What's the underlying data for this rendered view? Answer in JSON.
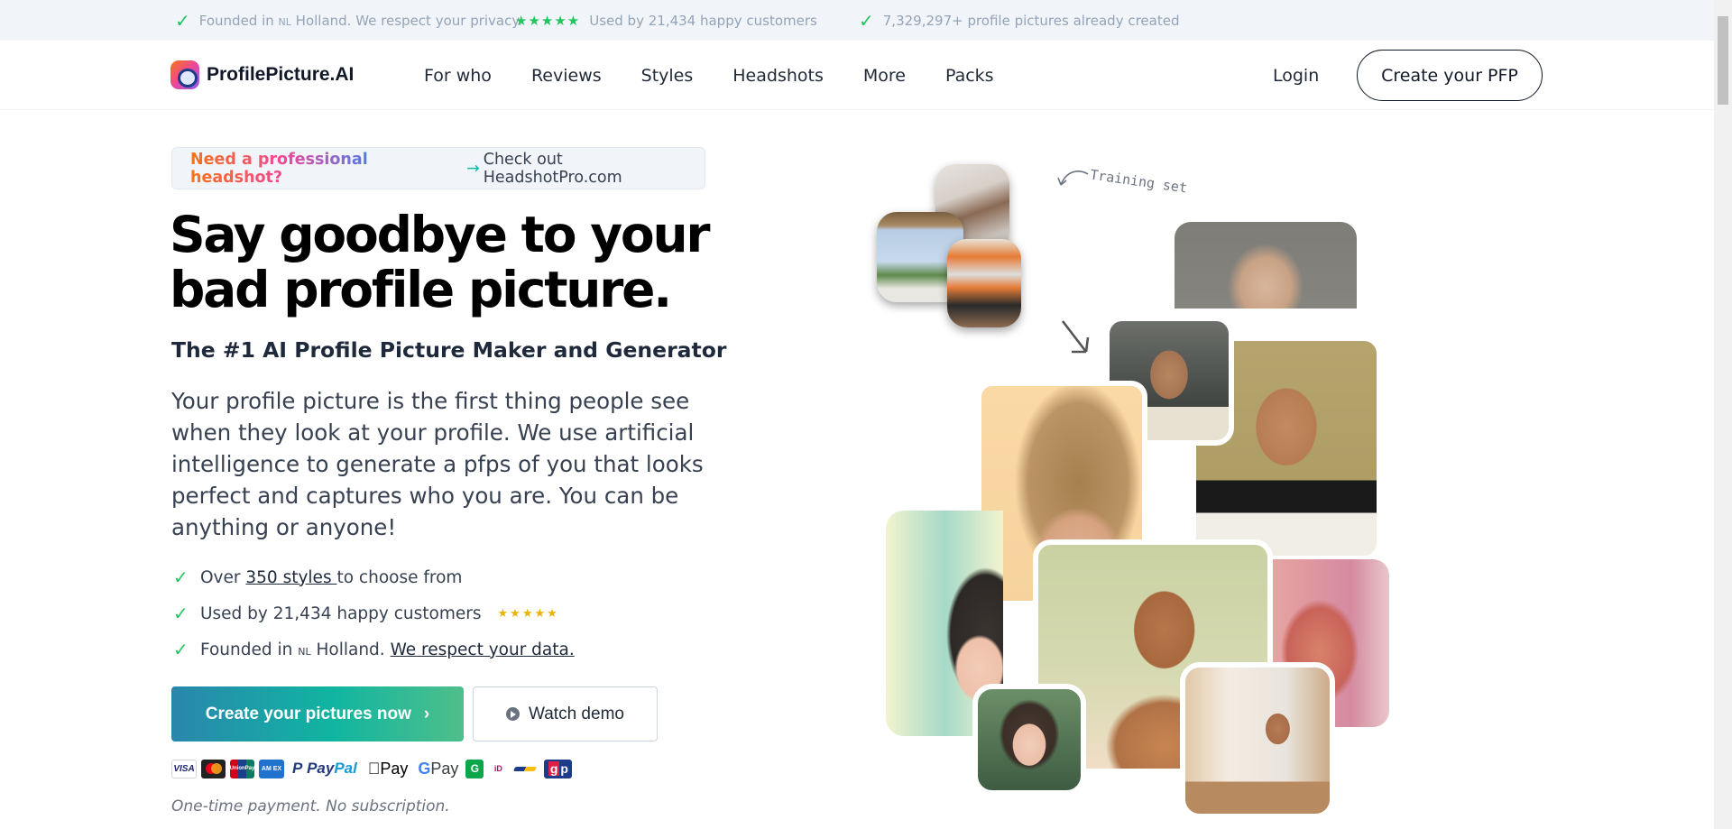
{
  "topbar": {
    "items": [
      {
        "icon": "check-icon",
        "prefix": "Founded in ",
        "country": "NL",
        "suffix": " Holland. We respect your privacy."
      },
      {
        "icon": "stars-icon",
        "stars": "★★★★★",
        "rating_stars": 5,
        "text": "Used by 21,434 happy customers"
      },
      {
        "icon": "check-icon",
        "text": "7,329,297+ profile pictures already created"
      }
    ]
  },
  "nav": {
    "brand": "ProfilePicture.AI",
    "links": [
      "For who",
      "Reviews",
      "Styles",
      "Headshots",
      "More",
      "Packs"
    ],
    "login": "Login",
    "cta": "Create your PFP"
  },
  "banner": {
    "highlight": "Need a professional headshot?",
    "arrow": "→",
    "text": "Check out HeadshotPro.com"
  },
  "hero": {
    "headline_line1": "Say goodbye to your",
    "headline_line2": "bad profile picture.",
    "subheading": "The #1 AI Profile Picture Maker and Generator",
    "paragraph": "Your profile picture is the first thing people see when they look at your profile. We use artificial intelligence to generate a pfps of you that looks perfect and captures who you are. You can be anything or anyone!"
  },
  "checklist": [
    {
      "before": "Over ",
      "link": "350 styles ",
      "after": "to choose from"
    },
    {
      "text": "Used by 21,434 happy customers",
      "stars": "★★★★★",
      "rating_stars": 5
    },
    {
      "before": "Founded in ",
      "country": "NL",
      "middle": " Holland. ",
      "link": "We respect your data."
    }
  ],
  "buttons": {
    "primary": "Create your pictures now",
    "primary_icon": "›",
    "secondary": "Watch demo"
  },
  "payments": {
    "methods": [
      "Visa",
      "Mastercard",
      "UnionPay",
      "American Express",
      "PayPal",
      "Apple Pay",
      "Google Pay",
      "Giropay",
      "iDEAL",
      "Bancontact",
      "Przelewy/GP"
    ],
    "visa": "VISA",
    "unionpay": "UnionPay",
    "amex": "AM EX",
    "paypal_a": "Pay",
    "paypal_b": "Pal",
    "apple": " Pay",
    "gpay_g": "G",
    "gpay": " Pay",
    "giro": "G",
    "ideal": "iD",
    "gp_g": "g",
    "gp_p": "p"
  },
  "note": "One-time payment. No subscription.",
  "collage": {
    "annotation": "Training set",
    "training_photos": [
      "selfie-window",
      "cactus-rooftop",
      "supermarket-peace-sign"
    ],
    "generated_photos": [
      "grey-portrait",
      "fairy-portrait",
      "tuxedo-portrait",
      "peach-hair-portrait",
      "headband-illustration",
      "green-shoulder-portrait",
      "pink-painted-portrait",
      "anime-portrait",
      "cafe-smiling-portrait"
    ]
  },
  "colors": {
    "accent_green": "#22c55e",
    "cta_gradient_start": "#2a86ad",
    "cta_gradient_end": "#4fbf8a",
    "topbar_bg": "#f1f5f9",
    "star_gold": "#eab308"
  }
}
